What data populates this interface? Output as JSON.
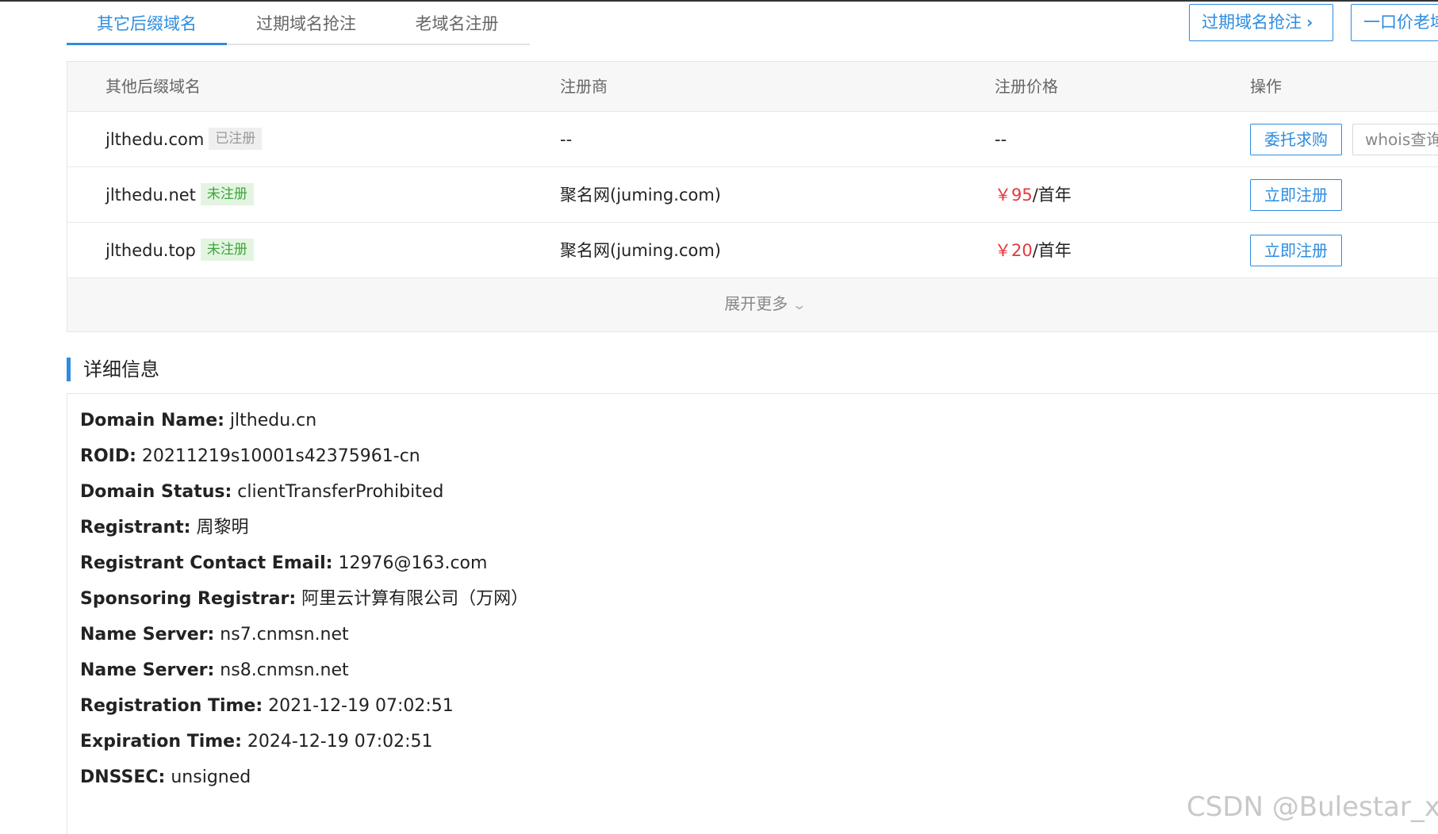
{
  "tabs": [
    {
      "label": "其它后缀域名",
      "active": true
    },
    {
      "label": "过期域名抢注",
      "active": false
    },
    {
      "label": "老域名注册",
      "active": false
    }
  ],
  "top_buttons": {
    "expired_snap": "过期域名抢注",
    "fixed_price": "一口价老域"
  },
  "table": {
    "headers": [
      "其他后缀域名",
      "注册商",
      "注册价格",
      "操作"
    ],
    "rows": [
      {
        "domain": "jlthedu.com",
        "status": "已注册",
        "registrar": "--",
        "price": "--",
        "price_unit": "",
        "action1": "委托求购",
        "action2": "whois查询"
      },
      {
        "domain": "jlthedu.net",
        "status": "未注册",
        "registrar": "聚名网(juming.com)",
        "price": "￥95",
        "price_unit": "/首年",
        "action1": "立即注册"
      },
      {
        "domain": "jlthedu.top",
        "status": "未注册",
        "registrar": "聚名网(juming.com)",
        "price": "￥20",
        "price_unit": "/首年",
        "action1": "立即注册"
      }
    ],
    "more": "展开更多"
  },
  "detail": {
    "title": "详细信息",
    "items": [
      {
        "key": "Domain Name:",
        "value": "jlthedu.cn"
      },
      {
        "key": "ROID:",
        "value": "20211219s10001s42375961-cn"
      },
      {
        "key": "Domain Status:",
        "value": "clientTransferProhibited"
      },
      {
        "key": "Registrant:",
        "value": "周黎明"
      },
      {
        "key": "Registrant Contact Email:",
        "value": "12976@163.com"
      },
      {
        "key": "Sponsoring Registrar:",
        "value": "阿里云计算有限公司（万网）"
      },
      {
        "key": "Name Server:",
        "value": "ns7.cnmsn.net"
      },
      {
        "key": "Name Server:",
        "value": "ns8.cnmsn.net"
      },
      {
        "key": "Registration Time:",
        "value": "2021-12-19 07:02:51"
      },
      {
        "key": "Expiration Time:",
        "value": "2024-12-19 07:02:51"
      },
      {
        "key": "DNSSEC:",
        "value": "unsigned"
      }
    ]
  },
  "watermark": "CSDN @Bulestar_xx",
  "colors": {
    "accent": "#2d8ce0",
    "price": "#e4393c",
    "available": "#3ea63a"
  }
}
